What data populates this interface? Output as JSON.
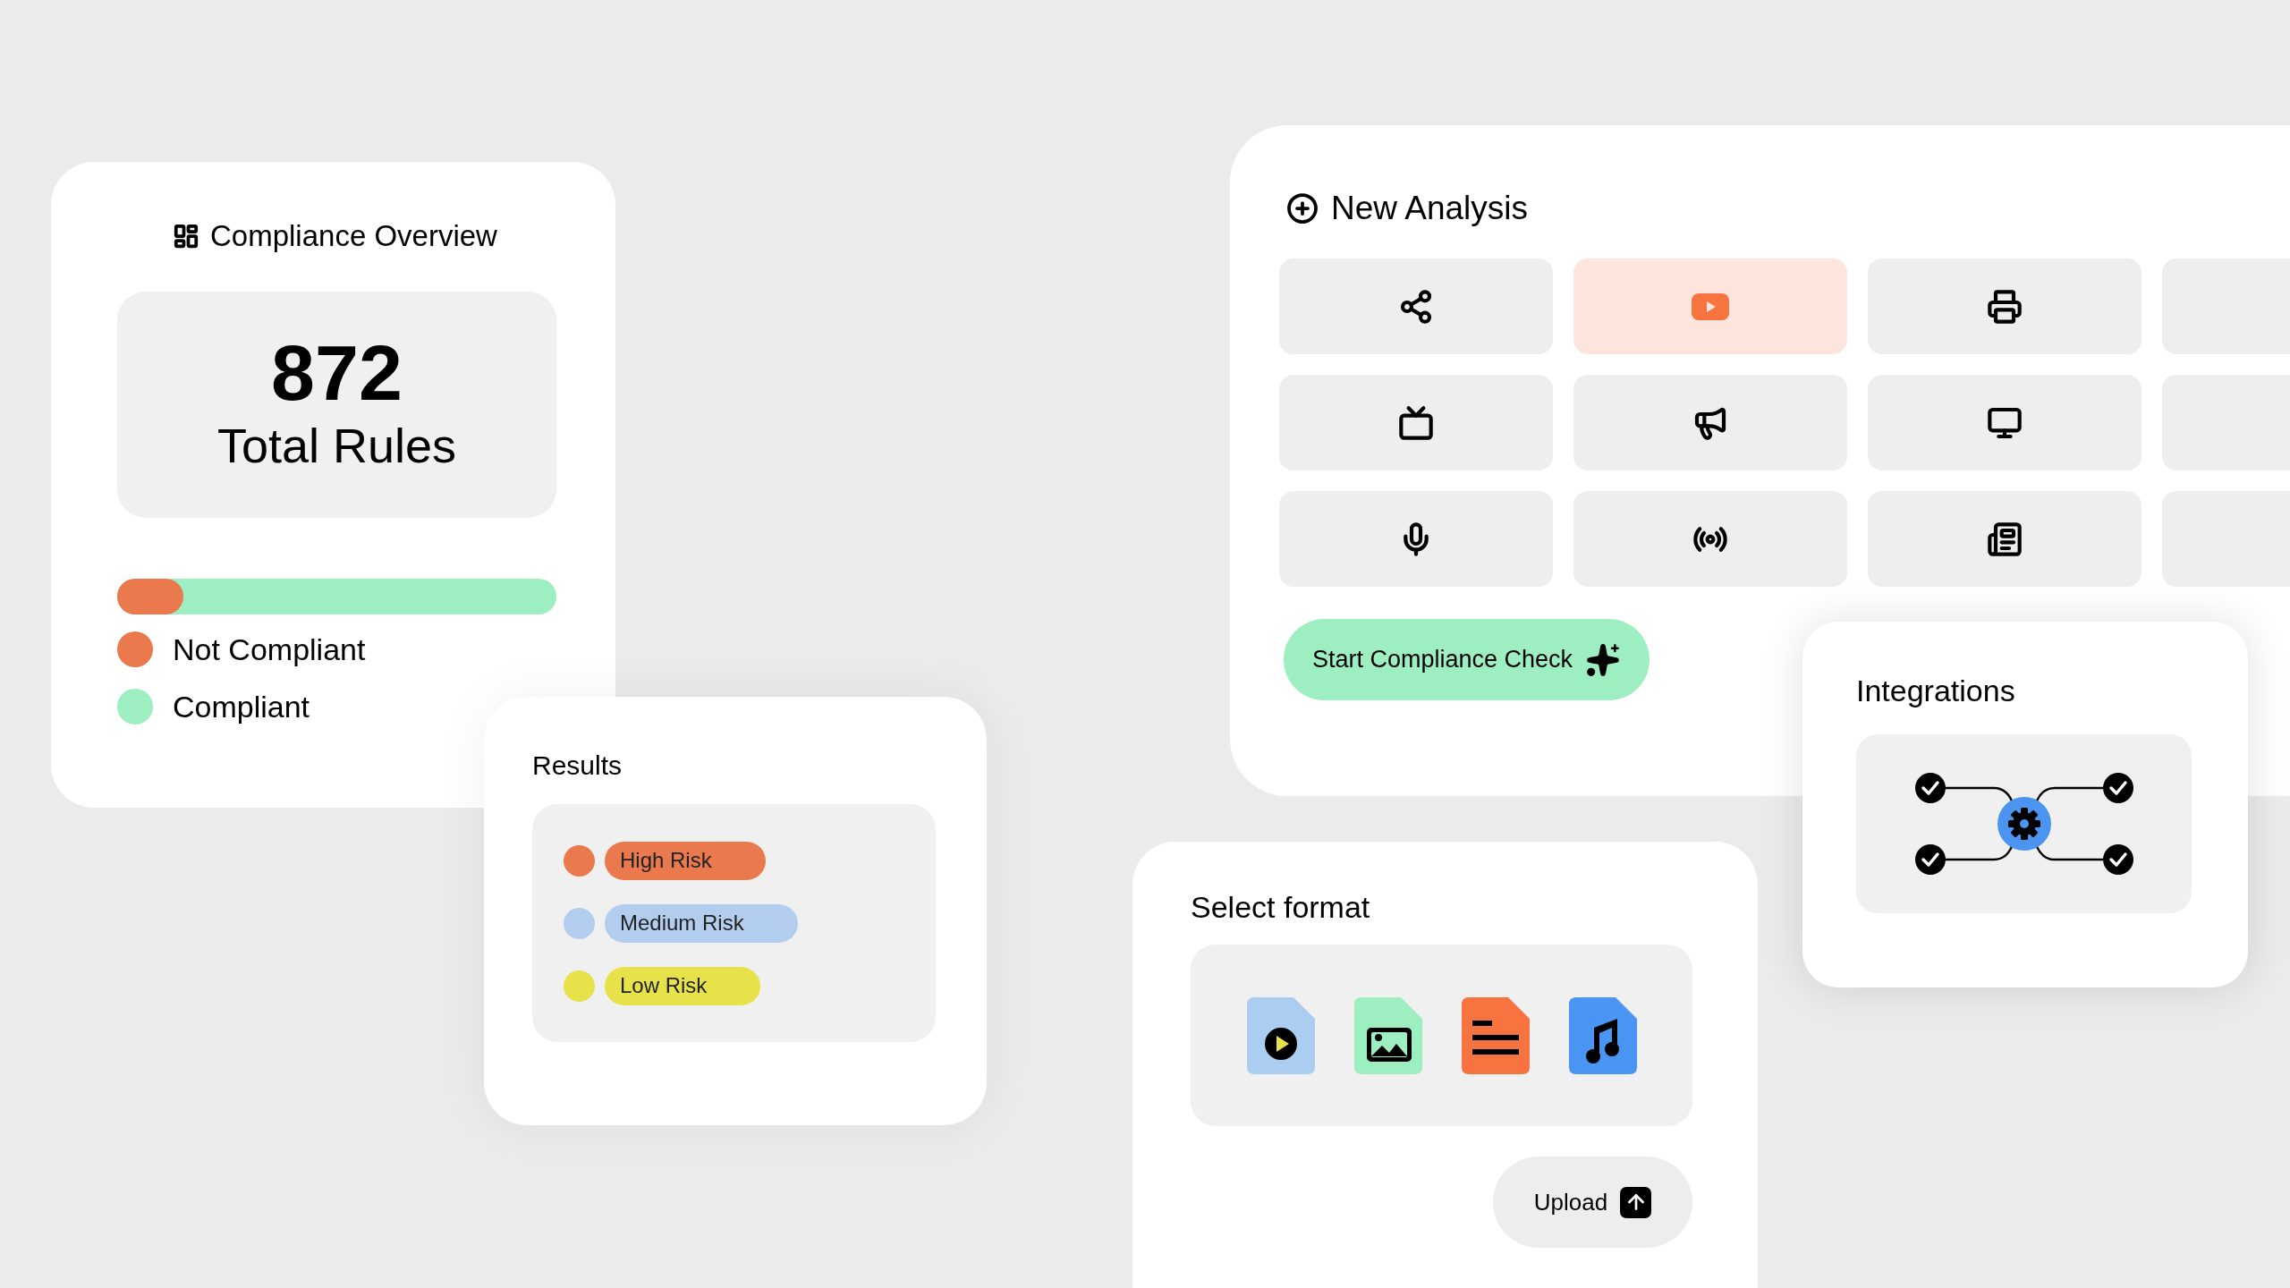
{
  "overview": {
    "title": "Compliance Overview",
    "total": "872",
    "total_label": "Total Rules",
    "level": 0.15,
    "legend": [
      {
        "label": "Not Compliant",
        "color": "#ea7a4d"
      },
      {
        "label": "Compliant",
        "color": "#9deec0"
      }
    ]
  },
  "results": {
    "title": "Results",
    "items": [
      {
        "label": "High Risk",
        "color": "#ea7a4d"
      },
      {
        "label": "Medium Risk",
        "color": "#b3cdee"
      },
      {
        "label": "Low Risk",
        "color": "#e7e24a"
      }
    ]
  },
  "new_analysis": {
    "title": "New Analysis",
    "tiles": [
      {
        "kind": "share",
        "selected": false
      },
      {
        "kind": "video",
        "selected": true
      },
      {
        "kind": "printer",
        "selected": false
      },
      {
        "kind": "empty",
        "selected": false
      },
      {
        "kind": "tv",
        "selected": false
      },
      {
        "kind": "megaphone",
        "selected": false
      },
      {
        "kind": "monitor",
        "selected": false
      },
      {
        "kind": "empty",
        "selected": false
      },
      {
        "kind": "mic",
        "selected": false
      },
      {
        "kind": "radio",
        "selected": false
      },
      {
        "kind": "newspaper",
        "selected": false
      },
      {
        "kind": "empty",
        "selected": false
      }
    ],
    "button": "Start Compliance Check"
  },
  "integrations": {
    "title": "Integrations"
  },
  "select_format": {
    "title": "Select format",
    "formats": [
      {
        "kind": "video",
        "color": "#abcdf0"
      },
      {
        "kind": "image",
        "color": "#9deec0"
      },
      {
        "kind": "text",
        "color": "#f77440"
      },
      {
        "kind": "audio",
        "color": "#4a94f4"
      }
    ],
    "button": "Upload"
  }
}
